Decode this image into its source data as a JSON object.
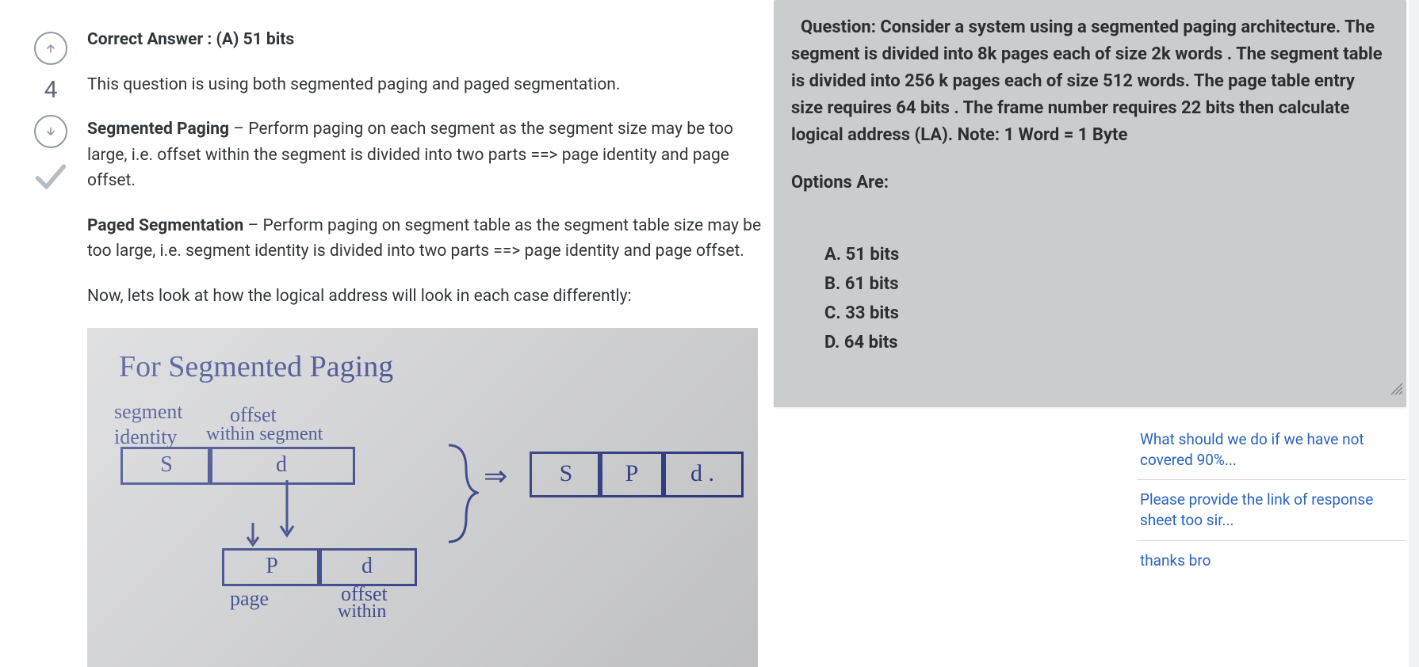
{
  "vote": {
    "score": "4"
  },
  "answer": {
    "correct_line_strong": "Correct Answer : (A) 51 bits",
    "p1": "This question is using both segmented paging and paged segmentation.",
    "sp_label": "Segmented Paging",
    "sp_text": " – Perform paging on each segment as the segment size may be too large, i.e. offset within the segment is divided into two parts ==> page identity and page offset.",
    "ps_label": "Paged Segmentation",
    "ps_text": " – Perform paging on segment table as the segment table size may be too large, i.e. segment identity is divided into two parts ==> page identity and page offset.",
    "p4": "Now, lets look at how the logical address will look in each case differently:"
  },
  "diagram": {
    "title": "For  Segmented  Paging",
    "seg_label_1": "segment",
    "seg_label_2": "identity",
    "off_label_1": "offset",
    "off_label_2": "within segment",
    "cell_S": "S",
    "cell_d": "d",
    "arrow": "⇒",
    "cell_S2": "S",
    "cell_P2": "P",
    "cell_d2": "d .",
    "cell_P": "P",
    "cell_d3": "d",
    "poff_1": "offset",
    "poff_2": "within",
    "page_label": "page"
  },
  "question": {
    "full": "Question: Consider a system using  a segmented paging architecture. The segment is divided into 8k pages each of size 2k words . The segment table is divided into 256 k pages each of size 512 words. The page table entry size requires 64 bits . The frame number requires 22 bits then calculate logical address (LA). Note: 1 Word = 1 Byte",
    "options_head": "Options Are:",
    "options": [
      "A. 51 bits",
      "B. 61 bits",
      "C. 33 bits",
      "D. 64 bits"
    ]
  },
  "related": {
    "r1": "What should we do if we have not covered 90%...",
    "r2": "Please provide the link of response sheet too sir...",
    "r3": "thanks bro"
  }
}
